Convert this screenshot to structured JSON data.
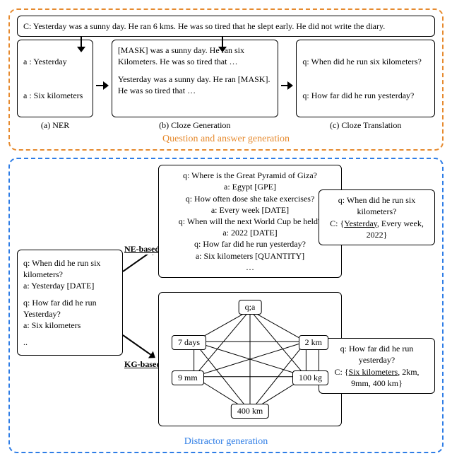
{
  "qa": {
    "context": "C: Yesterday was a sunny day. He ran 6 kms. He was so tired that he slept early. He did not write the diary.",
    "ner": {
      "a1": "a : Yesterday",
      "a2": "a : Six kilometers",
      "label": "(a) NER"
    },
    "cloze": {
      "line1": "[MASK] was a sunny day. He ran six Kilometers. He was so tired that …",
      "line2": "Yesterday was a sunny day. He ran [MASK]. He was so tired that …",
      "label": "(b) Cloze Generation"
    },
    "trans": {
      "q1": "q: When did he run six kilometers?",
      "q2": "q: How far did he run yesterday?",
      "label": "(c) Cloze Translation"
    },
    "caption": "Question and answer generation"
  },
  "dist": {
    "left": {
      "q1": "q: When did he run six kilometers?",
      "a1": "a: Yesterday [DATE]",
      "q2": "q: How far did he run Yesterday?",
      "a2": "a: Six kilometers",
      "dots": ".."
    },
    "ne": {
      "label": "NE-based",
      "l1": "q: Where is the Great Pyramid of Giza?",
      "l2": "a: Egypt [GPE]",
      "l3": "q: How often dose she take exercises?",
      "l4": "a: Every week [DATE]",
      "l5": "q: When will the next World Cup be held?",
      "l6": "a: 2022 [DATE]",
      "l7": "q: How far did he run yesterday?",
      "l8": "a: Six kilometers [QUANTITY]",
      "l9": "…"
    },
    "ne_out": {
      "q": "q: When did he run six kilometers?",
      "c_prefix": "C: {",
      "c_ans": "Yesterday",
      "c_rest": ", Every week, 2022}"
    },
    "kg": {
      "label": "KG-based",
      "nodes": {
        "qa": "q;a",
        "n7": "7 days",
        "n2": "2 km",
        "n9": "9 mm",
        "n100": "100 kg",
        "n400": "400 km"
      }
    },
    "kg_out": {
      "q": "q: How far did he run yesterday?",
      "c_prefix": "C: {",
      "c_ans": "Six kilometers",
      "c_rest": ", 2km, 9mm, 400 km}"
    },
    "caption": "Distractor generation"
  }
}
